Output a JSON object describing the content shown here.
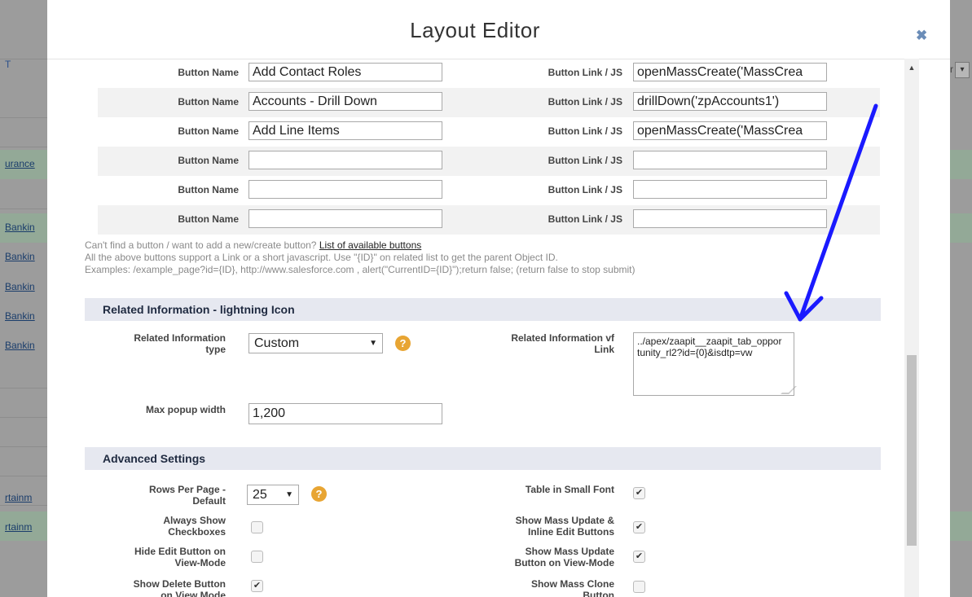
{
  "background": {
    "left_links": [
      "urance",
      "Bankin",
      "Bankin",
      "Bankin",
      "Bankin",
      "Bankin",
      "rtainm",
      "rtainm"
    ]
  },
  "modal": {
    "title": "Layout Editor",
    "close_icon": "close-icon"
  },
  "buttons": {
    "label_name": "Button Name",
    "label_link": "Button Link / JS",
    "rows": [
      {
        "name": "Add Contact Roles",
        "link": "openMassCreate('MassCrea"
      },
      {
        "name": "Accounts - Drill Down",
        "link": "drillDown('zpAccounts1')"
      },
      {
        "name": "Add Line Items",
        "link": "openMassCreate('MassCrea"
      },
      {
        "name": "",
        "link": ""
      },
      {
        "name": "",
        "link": ""
      },
      {
        "name": "",
        "link": ""
      }
    ]
  },
  "help": {
    "line1_prefix": "Can't find a button / want to add a new/create button? ",
    "line1_link": "List of available buttons",
    "line2": "All the above buttons support a Link or a short javascript. Use \"{ID}\" on related list to get the parent Object ID.",
    "line3": "Examples: /example_page?id={ID}, http://www.salesforce.com , alert(\"CurrentID={ID}\");return false; (return false to stop submit)"
  },
  "related": {
    "section_title": "Related Information - lightning Icon",
    "type_label_1": "Related Information",
    "type_label_2": "type",
    "type_value": "Custom",
    "vf_label_1": "Related Information vf",
    "vf_label_2": "Link",
    "vf_value": "../apex/zaapit__zaapit_tab_opportunity_rl2?id={0}&isdtp=vw",
    "max_popup_label": "Max popup width",
    "max_popup_value": "1,200"
  },
  "advanced": {
    "section_title": "Advanced Settings",
    "rows_per_page_label_1": "Rows Per Page -",
    "rows_per_page_label_2": "Default",
    "rows_per_page_value": "25",
    "always_show_cb_1": "Always Show",
    "always_show_cb_2": "Checkboxes",
    "always_show_cb_checked": false,
    "hide_edit_1": "Hide Edit Button on",
    "hide_edit_2": "View-Mode",
    "hide_edit_checked": false,
    "show_delete_1": "Show Delete Button",
    "show_delete_2": "on View Mode",
    "show_delete_checked": true,
    "small_font_label": "Table in Small Font",
    "small_font_checked": true,
    "mass_update_1": "Show Mass Update &",
    "mass_update_2": "Inline Edit Buttons",
    "mass_update_checked": true,
    "mass_update_view_1": "Show Mass Update",
    "mass_update_view_2": "Button on View-Mode",
    "mass_update_view_checked": true,
    "mass_clone_1": "Show Mass Clone",
    "mass_clone_2": "Button",
    "mass_clone_checked": false
  },
  "colors": {
    "annotation_arrow": "#1a1aff",
    "help_icon": "#e8a533",
    "section_bg": "#e6e8f0"
  }
}
